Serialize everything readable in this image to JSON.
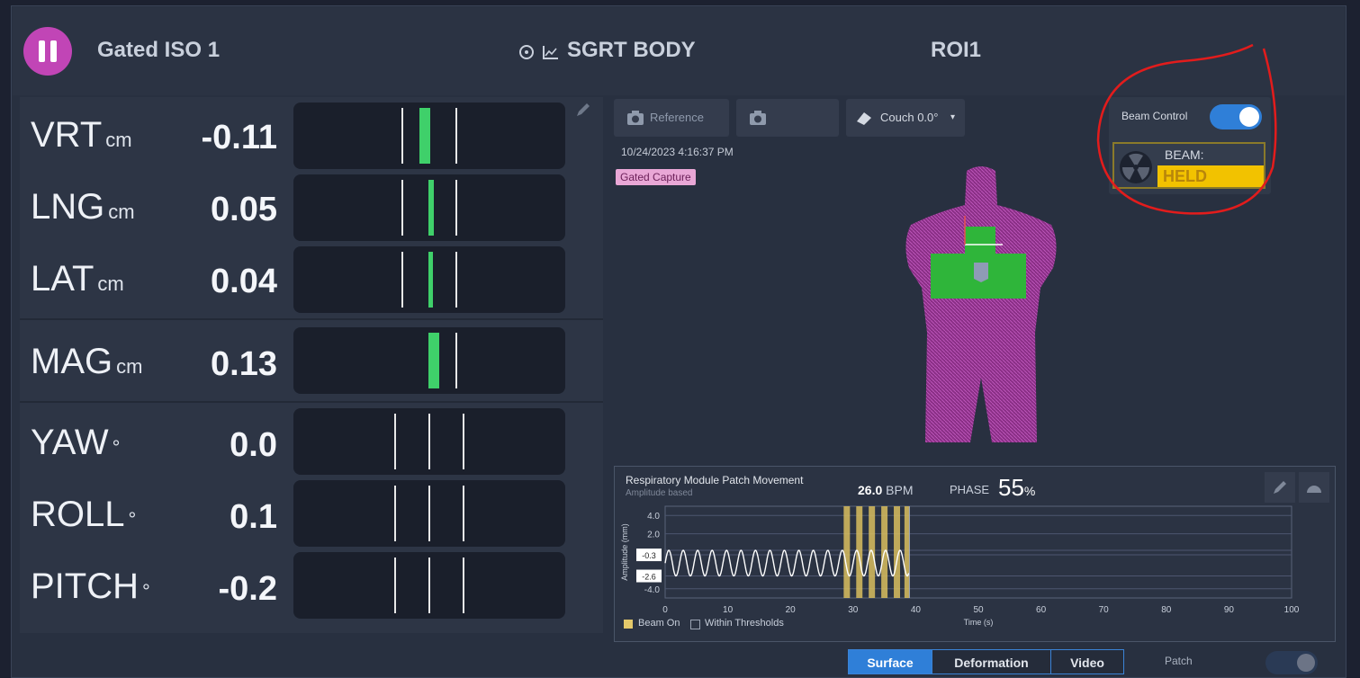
{
  "header": {
    "plan_name": "Gated ISO 1",
    "module_title": "SGRT BODY",
    "roi_name": "ROI1"
  },
  "metrics": [
    {
      "label": "VRT",
      "unit": "cm",
      "value": "-0.11"
    },
    {
      "label": "LNG",
      "unit": "cm",
      "value": "0.05"
    },
    {
      "label": "LAT",
      "unit": "cm",
      "value": "0.04"
    },
    {
      "label": "MAG",
      "unit": "cm",
      "value": "0.13"
    },
    {
      "label": "YAW",
      "unit": "°",
      "value": "0.0"
    },
    {
      "label": "ROLL",
      "unit": "°",
      "value": "0.1"
    },
    {
      "label": "PITCH",
      "unit": "°",
      "value": "-0.2"
    }
  ],
  "toolbar": {
    "reference_label": "Reference",
    "couch_label": "Couch 0.0°"
  },
  "capture": {
    "timestamp": "10/24/2023 4:16:37 PM",
    "tag": "Gated Capture"
  },
  "beam_control": {
    "label": "Beam Control",
    "toggle_on": true,
    "beam_label": "BEAM:",
    "beam_state": "HELD"
  },
  "respiratory": {
    "title": "Respiratory Module Patch Movement",
    "subtitle": "Amplitude based",
    "bpm_value": "26.0",
    "bpm_unit": "BPM",
    "phase_label": "PHASE",
    "phase_value": "55",
    "phase_unit": "%",
    "legend_beam_on": "Beam On",
    "legend_within": "Within Thresholds",
    "y_axis_label": "Amplitude (mm)",
    "x_axis_label": "Time (s)",
    "y_ticks": [
      "4.0",
      "2.0",
      "-0.3",
      "-2.6",
      "-4.0"
    ],
    "x_ticks": [
      "0",
      "10",
      "20",
      "30",
      "40",
      "50",
      "60",
      "70",
      "80",
      "90",
      "100"
    ]
  },
  "chart_data": {
    "type": "line",
    "xlabel": "Time (s)",
    "ylabel": "Amplitude (mm)",
    "xlim": [
      0,
      100
    ],
    "ylim": [
      -5,
      5
    ],
    "thresholds": [
      -0.3,
      -2.6
    ],
    "series": [
      {
        "name": "Patch Movement",
        "breathing_rate_bpm": 26.0,
        "x_end": 39,
        "amplitude_range": [
          -2.6,
          0.2
        ]
      }
    ],
    "beam_on_windows": [
      [
        28.5,
        29.5
      ],
      [
        30.5,
        31.5
      ],
      [
        32.5,
        33.5
      ],
      [
        34.5,
        35.5
      ],
      [
        36.5,
        37.5
      ],
      [
        38.2,
        39
      ]
    ]
  },
  "view_tabs": {
    "surface": "Surface",
    "deformation": "Deformation",
    "video": "Video",
    "active": "Surface"
  },
  "patch": {
    "label": "Patch"
  },
  "colors": {
    "accent_pink": "#c145b6",
    "beam_held": "#f2c200",
    "in_tolerance": "#3fd06a",
    "toggle_blue": "#2f7fd8"
  }
}
